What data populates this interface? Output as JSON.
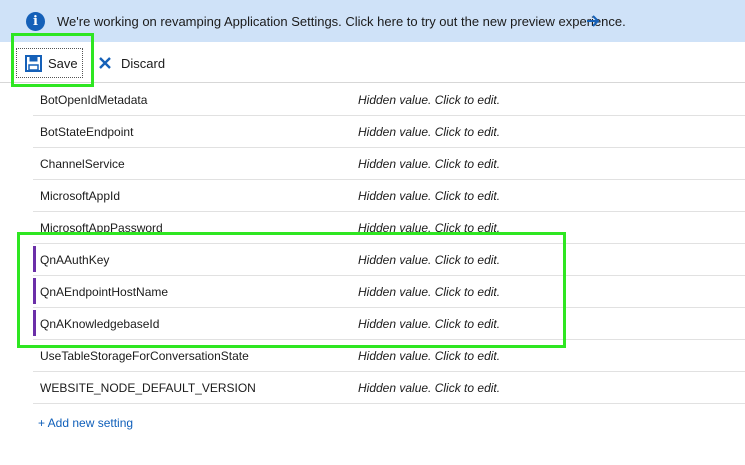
{
  "banner": {
    "icon": "info-icon",
    "message": "We're working on revamping Application Settings. Click here to try out the new preview experience.",
    "arrow_icon": "arrow-right-icon",
    "background_color": "#cfe2f8",
    "accent_color": "#1560b8"
  },
  "toolbar": {
    "save_label": "Save",
    "save_icon": "floppy-disk-icon",
    "discard_label": "Discard",
    "discard_icon": "x-icon"
  },
  "settings": [
    {
      "name": "BotOpenIdMetadata",
      "value": "Hidden value. Click to edit."
    },
    {
      "name": "BotStateEndpoint",
      "value": "Hidden value. Click to edit."
    },
    {
      "name": "ChannelService",
      "value": "Hidden value. Click to edit."
    },
    {
      "name": "MicrosoftAppId",
      "value": "Hidden value. Click to edit."
    },
    {
      "name": "MicrosoftAppPassword",
      "value": "Hidden value. Click to edit."
    },
    {
      "name": "QnAAuthKey",
      "value": "Hidden value. Click to edit.",
      "modified": true
    },
    {
      "name": "QnAEndpointHostName",
      "value": "Hidden value. Click to edit.",
      "modified": true
    },
    {
      "name": "QnAKnowledgebaseId",
      "value": "Hidden value. Click to edit.",
      "modified": true
    },
    {
      "name": "UseTableStorageForConversationState",
      "value": "Hidden value. Click to edit."
    },
    {
      "name": "WEBSITE_NODE_DEFAULT_VERSION",
      "value": "Hidden value. Click to edit."
    }
  ],
  "add_setting_label": "+ Add new setting",
  "colors": {
    "highlight": "#2ee621",
    "modified_marker": "#6b2fa8",
    "link": "#0f5fba"
  }
}
